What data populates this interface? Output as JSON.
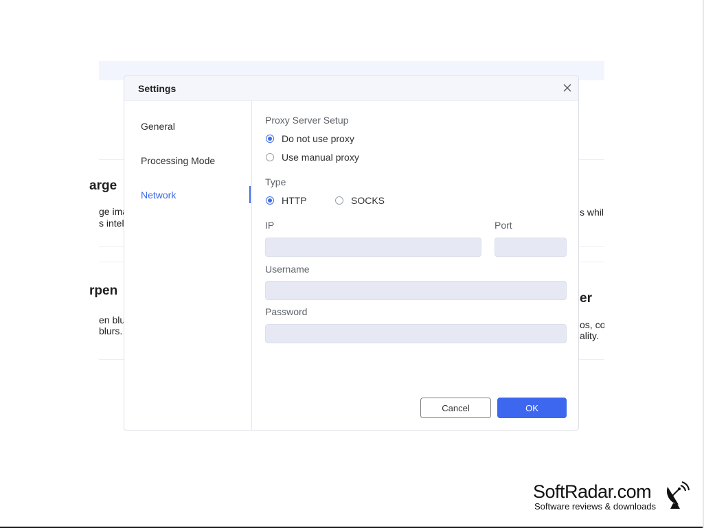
{
  "background": {
    "left_title_1": "arge",
    "left_line_1a": "ge ima",
    "left_line_1b": "s intel",
    "right_line_1a": "s whil",
    "left_title_2": "rpen",
    "left_line_2a": "en blu",
    "left_line_2b": "blurs.",
    "right_title_2": "er",
    "right_line_2a": "os, co",
    "right_line_2b": "ality."
  },
  "dialog": {
    "title": "Settings",
    "close_icon": "close-icon"
  },
  "sidebar": {
    "items": [
      {
        "label": "General",
        "active": false
      },
      {
        "label": "Processing Mode",
        "active": false
      },
      {
        "label": "Network",
        "active": true
      }
    ]
  },
  "network": {
    "proxy_section_label": "Proxy Server Setup",
    "proxy_options": [
      {
        "label": "Do not use proxy",
        "checked": true
      },
      {
        "label": "Use manual proxy",
        "checked": false
      }
    ],
    "type_label": "Type",
    "type_options": [
      {
        "label": "HTTP",
        "checked": true
      },
      {
        "label": "SOCKS",
        "checked": false
      }
    ],
    "ip_label": "IP",
    "ip_value": "",
    "port_label": "Port",
    "port_value": "",
    "username_label": "Username",
    "username_value": "",
    "password_label": "Password",
    "password_value": ""
  },
  "buttons": {
    "cancel_label": "Cancel",
    "ok_label": "OK"
  },
  "watermark": {
    "main": "SoftRadar.com",
    "sub": "Software reviews & downloads",
    "icon": "satellite-dish-icon"
  },
  "colors": {
    "accent": "#3e6ae8",
    "ok_button": "#3e67f0",
    "input_bg": "#e6e9f4"
  }
}
